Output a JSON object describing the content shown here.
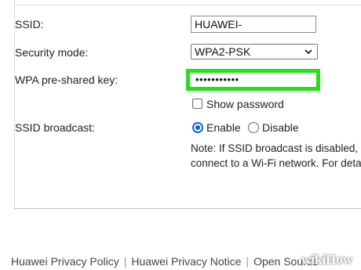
{
  "form": {
    "ssid_label": "SSID:",
    "ssid_value": "HUAWEI-",
    "security_label": "Security mode:",
    "security_value": "WPA2-PSK",
    "psk_label": "WPA pre-shared key:",
    "psk_value": "•••••••••••",
    "show_password_label": "Show password",
    "show_password_checked": false,
    "broadcast_label": "SSID broadcast:",
    "enable_label": "Enable",
    "disable_label": "Disable",
    "broadcast_selected": "Enable",
    "note_line1": "Note: If SSID broadcast is disabled,",
    "note_line2": "connect to a Wi-Fi network. For deta"
  },
  "colors": {
    "highlight": "#22e11a",
    "radio_accent": "#0b63d6"
  },
  "footer": {
    "link1": "Huawei Privacy Policy",
    "link2": "Huawei Privacy Notice",
    "link3": "Open Source"
  },
  "watermark": "wikiHow"
}
